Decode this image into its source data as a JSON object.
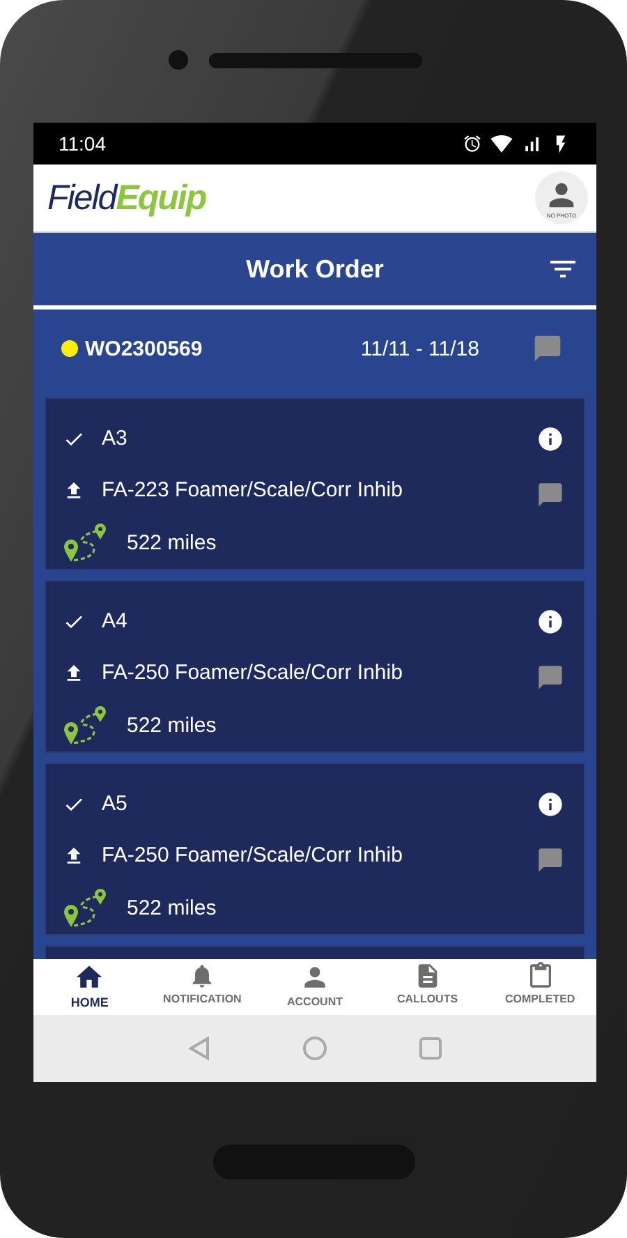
{
  "status_bar": {
    "time": "11:04"
  },
  "header": {
    "logo_part_1": "Field",
    "logo_part_2": "Equip",
    "avatar_label": "NO PHOTO"
  },
  "title_bar": {
    "title": "Work Order"
  },
  "order": {
    "color": "#ffee00",
    "number": "WO2300569",
    "dates": "11/11 - 11/18"
  },
  "items": [
    {
      "checked": true,
      "code": "A3",
      "product": "FA-223 Foamer/Scale/Corr Inhib",
      "distance": "522 miles"
    },
    {
      "checked": true,
      "code": "A4",
      "product": "FA-250 Foamer/Scale/Corr Inhib",
      "distance": "522 miles"
    },
    {
      "checked": true,
      "code": "A5",
      "product": "FA-250 Foamer/Scale/Corr Inhib",
      "distance": "522 miles"
    }
  ],
  "bottom_nav": [
    {
      "kind": "home",
      "label": "HOME",
      "selected": true
    },
    {
      "kind": "notification",
      "label": "NOTIFICATION",
      "selected": false
    },
    {
      "kind": "account",
      "label": "ACCOUNT",
      "selected": false
    },
    {
      "kind": "callouts",
      "label": "CALLOUTS",
      "selected": false
    },
    {
      "kind": "completed",
      "label": "COMPLETED",
      "selected": false
    }
  ]
}
